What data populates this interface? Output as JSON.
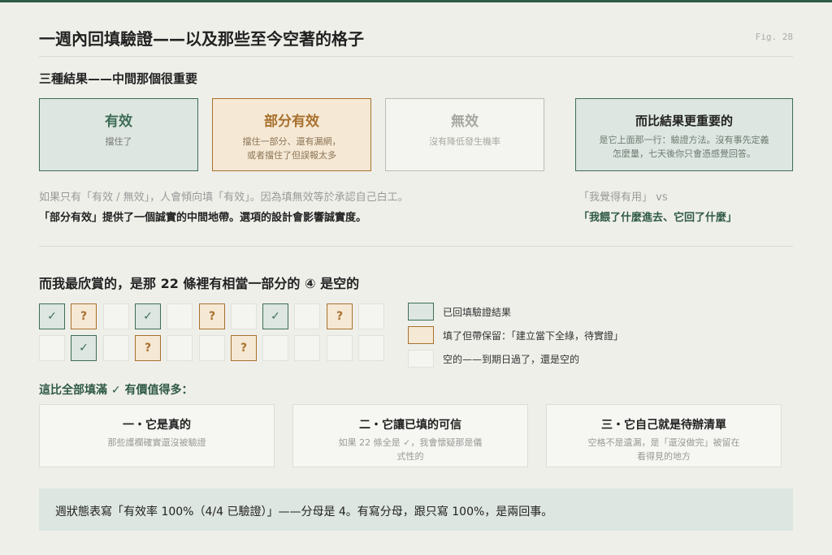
{
  "header": {
    "title": "一週內回填驗證——以及那些至今空著的格子",
    "fig": "Fig. 28"
  },
  "section1": {
    "heading": "三種結果——中間那個很重要",
    "boxes": [
      {
        "title": "有效",
        "desc": "擋住了"
      },
      {
        "title": "部分有效",
        "desc1": "擋住一部分、還有漏網，",
        "desc2": "或者擋住了但誤報太多"
      },
      {
        "title": "無效",
        "desc": "沒有降低發生機率"
      }
    ],
    "side": {
      "title": "而比結果更重要的",
      "desc1": "是它上面那一行：驗證方法。沒有事先定義",
      "desc2": "怎麼量，七天後你只會憑感覺回答。"
    },
    "note1": "如果只有「有效 / 無效」，人會傾向填「有效」。因為填無效等於承認自己白工。",
    "note2": "「部分有效」提供了一個誠實的中間地帶。選項的設計會影響誠實度。",
    "quote1": "「我覺得有用」 vs",
    "quote2": "「我餵了什麼進去、它回了什麼」"
  },
  "section2": {
    "heading": "而我最欣賞的，是那 22 條裡有相當一部分的 ④ 是空的",
    "grid_row1": [
      "v",
      "q",
      "e",
      "v",
      "e",
      "q",
      "e",
      "v",
      "e",
      "q",
      "e"
    ],
    "grid_row2": [
      "e",
      "v",
      "e",
      "q",
      "e",
      "e",
      "q",
      "e",
      "e",
      "e",
      "e"
    ],
    "check_glyph": "✓",
    "q_glyph": "?",
    "legend": [
      {
        "kind": "v",
        "label": "已回填驗證結果"
      },
      {
        "kind": "q",
        "label": "填了但帶保留：「建立當下全綠，待實證」"
      },
      {
        "kind": "e",
        "label": "空的——到期日過了，還是空的"
      }
    ],
    "subheading": "這比全部填滿 ✓ 有價值得多："
  },
  "cards": [
    {
      "title": "一・它是真的",
      "desc1": "那些護欄確實還沒被驗證",
      "desc2": ""
    },
    {
      "title": "二・它讓已填的可信",
      "desc1": "如果 22 條全是 ✓，我會懷疑那是儀",
      "desc2": "式性的"
    },
    {
      "title": "三・它自己就是待辦清單",
      "desc1": "空格不是遺漏，是「還沒做完」被留在",
      "desc2": "看得見的地方"
    }
  ],
  "footer": {
    "text": "週狀態表寫「有效率 100%（4/4 已驗證）」——分母是 4。有寫分母，跟只寫 100%，是兩回事。"
  },
  "colors": {
    "green": "#3e6c57",
    "amber": "#a8712f",
    "empty": "#e1e1dc"
  }
}
